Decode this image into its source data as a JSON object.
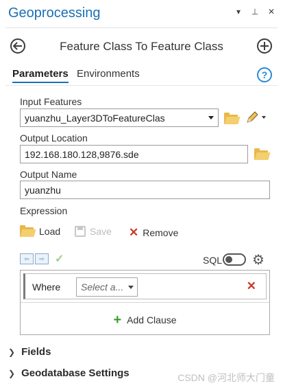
{
  "pane": {
    "title": "Geoprocessing",
    "controls": [
      "▾",
      "⊥",
      "✕"
    ]
  },
  "tool": {
    "title": "Feature Class To Feature Class"
  },
  "tabs": [
    {
      "label": "Parameters",
      "active": true
    },
    {
      "label": "Environments",
      "active": false
    }
  ],
  "params": {
    "input_features": {
      "label": "Input Features",
      "value": "yuanzhu_Layer3DToFeatureClas"
    },
    "output_location": {
      "label": "Output Location",
      "value": "192.168.180.128,9876.sde"
    },
    "output_name": {
      "label": "Output Name",
      "value": "yuanzhu"
    },
    "expression": {
      "label": "Expression",
      "load_label": "Load",
      "save_label": "Save",
      "remove_label": "Remove",
      "sql_label": "SQL",
      "sql_on": false,
      "clause": {
        "where_label": "Where",
        "select_placeholder": "Select a..."
      },
      "add_clause_label": "Add Clause"
    }
  },
  "sections": [
    {
      "label": "Fields",
      "expanded": false
    },
    {
      "label": "Geodatabase Settings",
      "expanded": false
    }
  ],
  "watermark": "CSDN @河北师大门童",
  "colors": {
    "accent": "#1a6fb4",
    "remove": "#c73b2b",
    "add": "#3a9e2e",
    "folder": "#e8b84a"
  },
  "icons": [
    "back-icon",
    "add-icon",
    "help-icon",
    "folder-icon",
    "pencil-icon",
    "load-icon",
    "save-icon",
    "remove-icon",
    "gear-icon",
    "checkmark-icon",
    "chevron-right-icon"
  ]
}
